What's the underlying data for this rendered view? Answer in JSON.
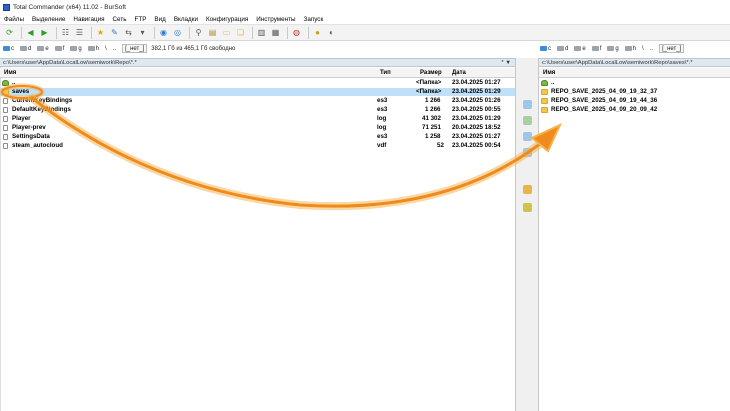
{
  "window": {
    "title": "Total Commander (x64) 11.02 - BurSoft"
  },
  "menu": [
    "Файлы",
    "Выделение",
    "Навигация",
    "Сеть",
    "FTP",
    "Вид",
    "Вкладки",
    "Конфигурация",
    "Инструменты",
    "Запуск"
  ],
  "left": {
    "drives": [
      "c",
      "d",
      "e",
      "f",
      "g",
      "h",
      "\\",
      ".."
    ],
    "drive_button": "[_нет_]",
    "free_space": "382,1 Гб из 465,1 Гб свободно",
    "path": "c:\\Users\\user\\AppData\\LocalLow\\semiwork\\Repo\\*.*",
    "path_btns": "* ▼",
    "columns": {
      "name": "Имя",
      "type": "Тип",
      "size": "Размер",
      "date": "Дата"
    },
    "rows": [
      {
        "name": "..",
        "type": "",
        "size": "<Папка>",
        "date": "23.04.2025 01:27",
        "icon": "up",
        "selected": false
      },
      {
        "name": "saves",
        "type": "",
        "size": "<Папка>",
        "date": "23.04.2025 01:29",
        "icon": "folder",
        "selected": true
      },
      {
        "name": "CurrentKeyBindings",
        "type": "es3",
        "size": "1 266",
        "date": "23.04.2025 01:26",
        "icon": "file",
        "selected": false
      },
      {
        "name": "DefaultKeyBindings",
        "type": "es3",
        "size": "1 266",
        "date": "23.04.2025 00:55",
        "icon": "file",
        "selected": false
      },
      {
        "name": "Player",
        "type": "log",
        "size": "41 302",
        "date": "23.04.2025 01:29",
        "icon": "file",
        "selected": false
      },
      {
        "name": "Player-prev",
        "type": "log",
        "size": "71 251",
        "date": "20.04.2025 18:52",
        "icon": "file",
        "selected": false
      },
      {
        "name": "SettingsData",
        "type": "es3",
        "size": "1 258",
        "date": "23.04.2025 01:27",
        "icon": "file",
        "selected": false
      },
      {
        "name": "steam_autocloud",
        "type": "vdf",
        "size": "52",
        "date": "23.04.2025 00:54",
        "icon": "file",
        "selected": false
      }
    ]
  },
  "right": {
    "drives": [
      "c",
      "d",
      "e",
      "f",
      "g",
      "h",
      "\\",
      ".."
    ],
    "drive_button": "[_нет_]",
    "path": "c:\\Users\\user\\AppData\\LocalLow\\semiwork\\Repo\\saves\\*.*",
    "columns": {
      "name": "Имя"
    },
    "rows": [
      {
        "name": "..",
        "icon": "up"
      },
      {
        "name": "REPO_SAVE_2025_04_09_19_32_37",
        "icon": "folder"
      },
      {
        "name": "REPO_SAVE_2025_04_09_19_44_36",
        "icon": "folder"
      },
      {
        "name": "REPO_SAVE_2025_04_09_20_09_42",
        "icon": "folder"
      }
    ]
  },
  "colors": {
    "selection": "#bfe0f6",
    "annotation": "#f08a1c",
    "folder": "#f3c84a"
  }
}
